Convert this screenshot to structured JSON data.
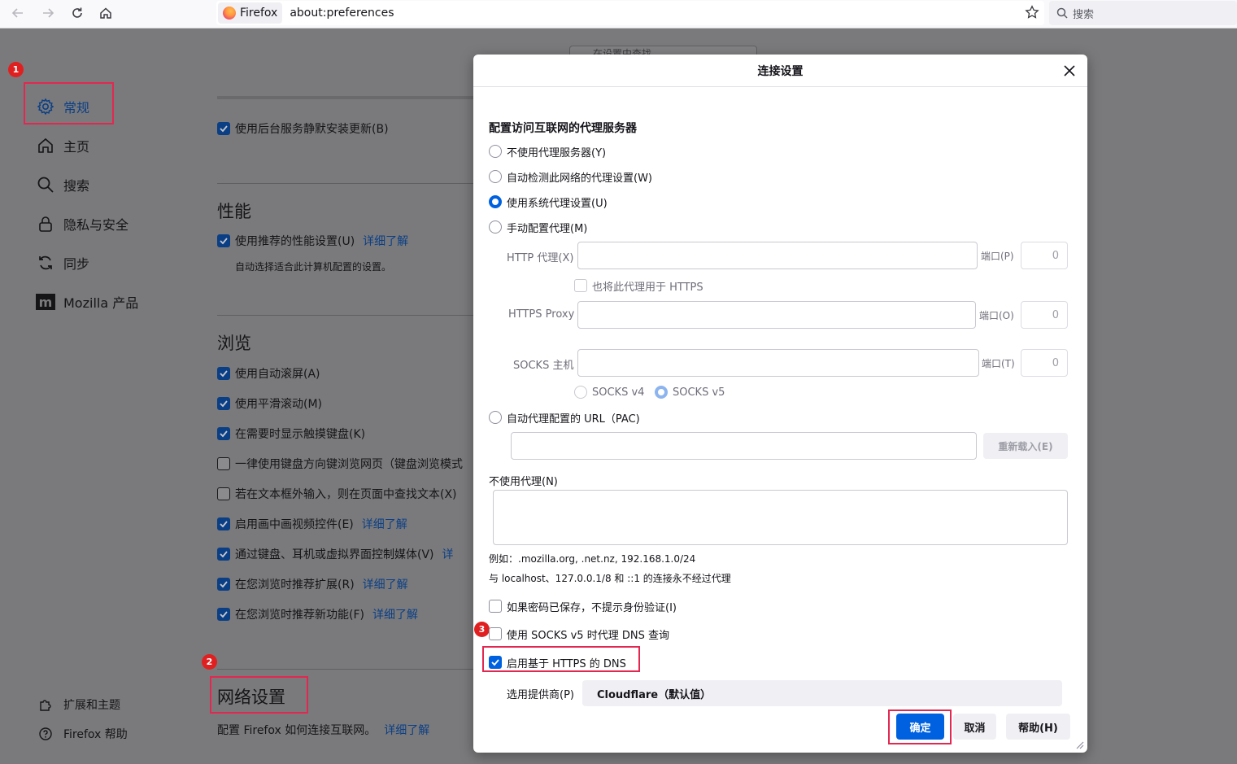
{
  "toolbar": {
    "identity_label": "Firefox",
    "url": "about:preferences",
    "search_placeholder": "搜索"
  },
  "sidebar": {
    "items": [
      {
        "label": "常规",
        "icon": "gear-icon"
      },
      {
        "label": "主页",
        "icon": "home-icon"
      },
      {
        "label": "搜索",
        "icon": "search-icon"
      },
      {
        "label": "隐私与安全",
        "icon": "lock-icon"
      },
      {
        "label": "同步",
        "icon": "sync-icon"
      },
      {
        "label": "Mozilla 产品",
        "icon": "mozilla-icon"
      }
    ],
    "footer": [
      {
        "label": "扩展和主题",
        "icon": "puzzle-icon"
      },
      {
        "label": "Firefox 帮助",
        "icon": "help-icon"
      }
    ]
  },
  "main": {
    "search_placeholder": "在设置中查找",
    "update_bg": "使用后台服务静默安装更新(B)",
    "perf": {
      "title": "性能",
      "recommended": "使用推荐的性能设置(U)",
      "learn_more": "详细了解",
      "desc": "自动选择适合此计算机配置的设置。"
    },
    "browse": {
      "title": "浏览",
      "items": [
        {
          "label": "使用自动滚屏(A)",
          "checked": true,
          "link": ""
        },
        {
          "label": "使用平滑滚动(M)",
          "checked": true,
          "link": ""
        },
        {
          "label": "在需要时显示触摸键盘(K)",
          "checked": true,
          "link": ""
        },
        {
          "label": "一律使用键盘方向键浏览网页（键盘浏览模式",
          "checked": false,
          "link": ""
        },
        {
          "label": "若在文本框外输入，则在页面中查找文本(X)",
          "checked": false,
          "link": ""
        },
        {
          "label": "启用画中画视频控件(E)",
          "checked": true,
          "link": "详细了解"
        },
        {
          "label": "通过键盘、耳机或虚拟界面控制媒体(V)",
          "checked": true,
          "link": "详"
        },
        {
          "label": "在您浏览时推荐扩展(R)",
          "checked": true,
          "link": "详细了解"
        },
        {
          "label": "在您浏览时推荐新功能(F)",
          "checked": true,
          "link": "详细了解"
        }
      ]
    },
    "network": {
      "title": "网络设置",
      "desc": "配置 Firefox 如何连接互联网。",
      "learn_more": "详细了解"
    }
  },
  "annotations": {
    "badge1": "1",
    "badge2": "2",
    "badge3": "3"
  },
  "dialog": {
    "title": "连接设置",
    "section_title": "配置访问互联网的代理服务器",
    "radio_none": "不使用代理服务器(Y)",
    "radio_auto_detect": "自动检测此网络的代理设置(W)",
    "radio_system": "使用系统代理设置(U)",
    "radio_manual": "手动配置代理(M)",
    "http_proxy_label": "HTTP 代理(X)",
    "port_p_label": "端口(P)",
    "http_port": "0",
    "also_https": "也将此代理用于 HTTPS",
    "https_proxy_label": "HTTPS Proxy",
    "port_o_label": "端口(O)",
    "https_port": "0",
    "socks_label": "SOCKS 主机",
    "port_t_label": "端口(T)",
    "socks_port": "0",
    "socks_v4": "SOCKS v4",
    "socks_v5": "SOCKS v5",
    "radio_pac": "自动代理配置的 URL（PAC)",
    "reload_button": "重新载入(E)",
    "no_proxy_label": "不使用代理(N)",
    "example_line": "例如：.mozilla.org, .net.nz, 192.168.1.0/24",
    "localhost_line": "与 localhost、127.0.0.1/8 和 ::1 的连接永不经过代理",
    "no_auth_prompt": "如果密码已保存，不提示身份验证(I)",
    "socks_dns": "使用 SOCKS v5 时代理 DNS 查询",
    "doh": "启用基于 HTTPS 的 DNS",
    "provider_label": "选用提供商(P)",
    "provider_value": "Cloudflare（默认值）",
    "ok_button": "确定",
    "cancel_button": "取消",
    "help_button": "帮助(H)"
  },
  "colors": {
    "accent": "#0061e0",
    "annotation_red": "#e22850",
    "page_dim": "#7a7a7c"
  }
}
